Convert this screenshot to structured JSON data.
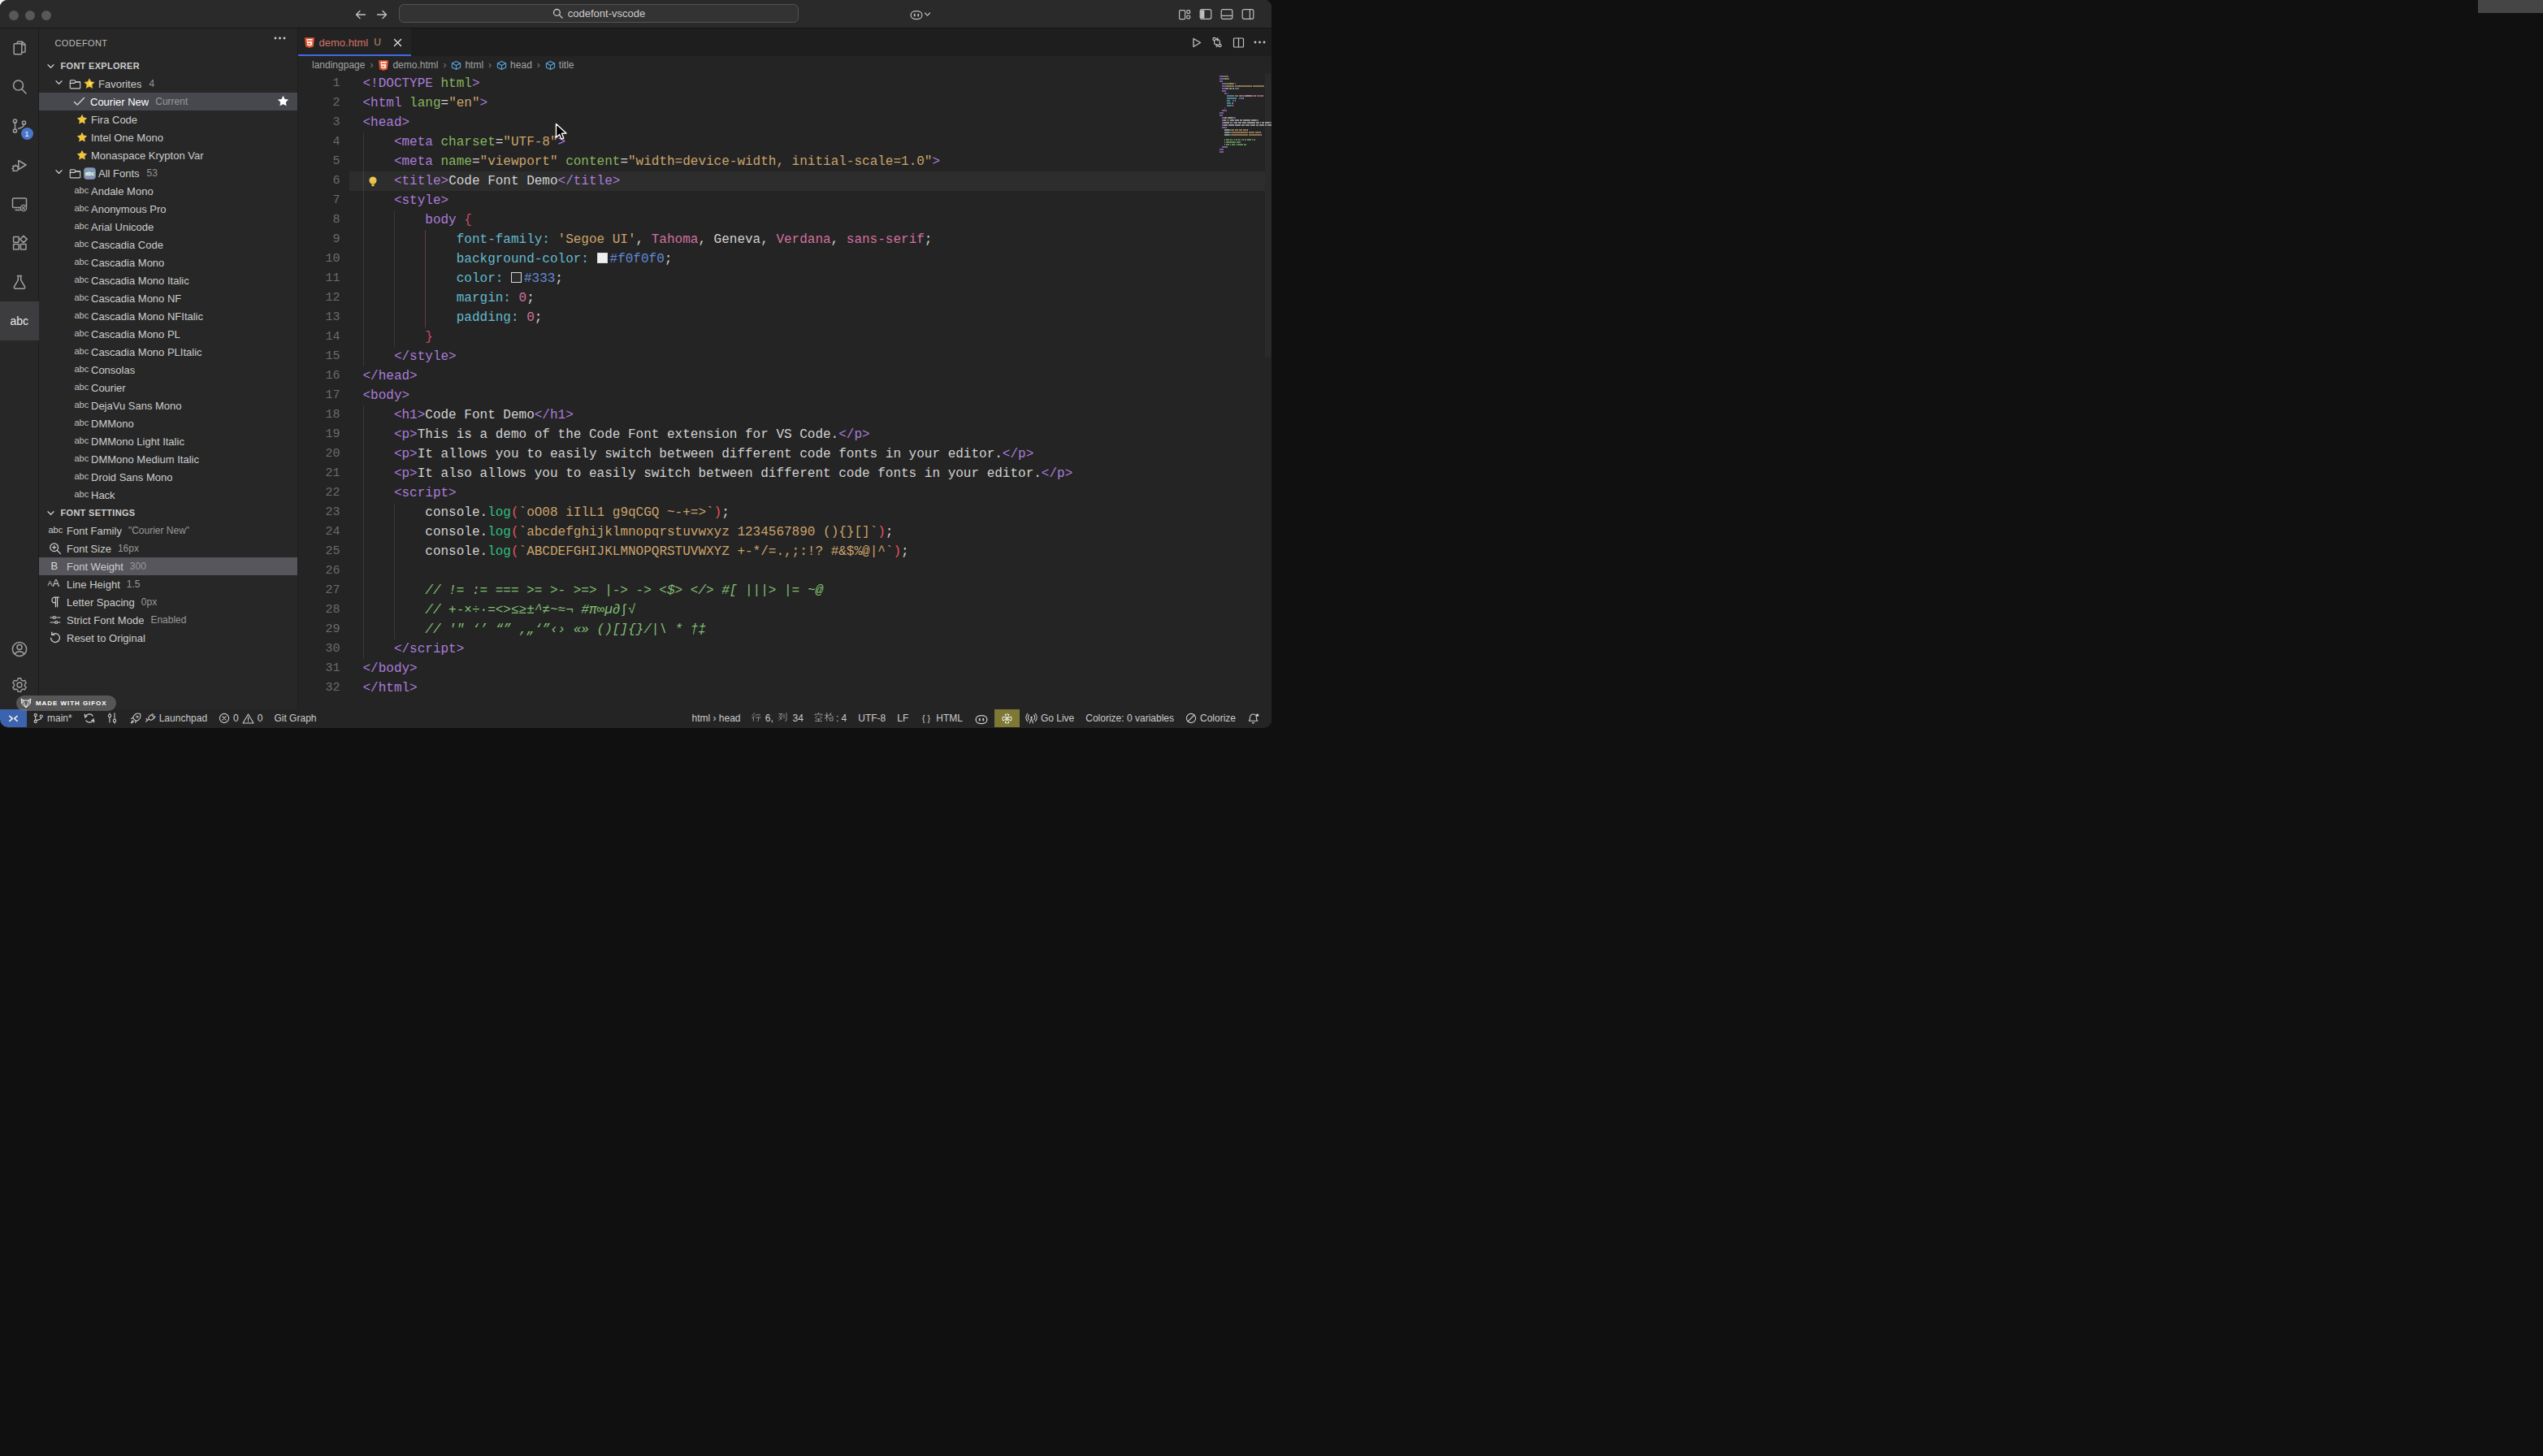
{
  "titlebar": {
    "traffic_lights": [
      "close",
      "minimize",
      "zoom"
    ],
    "nav_icons": [
      "arrow-left",
      "arrow-right"
    ],
    "search_text": "codefont-vscode",
    "right_icons": [
      "copilot",
      "chevron-down",
      "customize-layout",
      "toggle-sidebar",
      "toggle-panel",
      "toggle-secondary-sidebar"
    ]
  },
  "activity_bar": {
    "items": [
      {
        "id": "explorer",
        "icon": "files"
      },
      {
        "id": "search",
        "icon": "search"
      },
      {
        "id": "source-control",
        "icon": "source-control",
        "badge": "1"
      },
      {
        "id": "run-debug",
        "icon": "debug"
      },
      {
        "id": "remote-explorer",
        "icon": "remote-explorer"
      },
      {
        "id": "extensions",
        "icon": "extensions"
      },
      {
        "id": "testing",
        "icon": "beaker"
      },
      {
        "id": "codefont",
        "icon": "abc-text",
        "active": true,
        "label": "abc"
      }
    ],
    "bottom_items": [
      {
        "id": "accounts",
        "icon": "account"
      },
      {
        "id": "settings",
        "icon": "gear"
      }
    ]
  },
  "sidebar": {
    "title": "CODEFONT",
    "menu_icon": "ellipsis",
    "explorer_section": "FONT EXPLORER",
    "tree": [
      {
        "kind": "folder",
        "label": "Favorites",
        "count": "4",
        "badge": "star-emoji"
      },
      {
        "kind": "current",
        "label": "Courier New",
        "meta": "Current",
        "selected": true,
        "right_icon": "star-white"
      },
      {
        "kind": "fav",
        "label": "Fira Code"
      },
      {
        "kind": "fav",
        "label": "Intel One Mono"
      },
      {
        "kind": "fav",
        "label": "Monaspace Krypton Var"
      },
      {
        "kind": "folder",
        "label": "All Fonts",
        "count": "53",
        "badge": "abc-badge"
      },
      {
        "kind": "font",
        "label": "Andale Mono"
      },
      {
        "kind": "font",
        "label": "Anonymous Pro"
      },
      {
        "kind": "font",
        "label": "Arial Unicode"
      },
      {
        "kind": "font",
        "label": "Cascadia Code"
      },
      {
        "kind": "font",
        "label": "Cascadia Mono"
      },
      {
        "kind": "font",
        "label": "Cascadia Mono Italic"
      },
      {
        "kind": "font",
        "label": "Cascadia Mono NF"
      },
      {
        "kind": "font",
        "label": "Cascadia Mono NFItalic"
      },
      {
        "kind": "font",
        "label": "Cascadia Mono PL"
      },
      {
        "kind": "font",
        "label": "Cascadia Mono PLItalic"
      },
      {
        "kind": "font",
        "label": "Consolas"
      },
      {
        "kind": "font",
        "label": "Courier"
      },
      {
        "kind": "font",
        "label": "DejaVu Sans Mono"
      },
      {
        "kind": "font",
        "label": "DMMono"
      },
      {
        "kind": "font",
        "label": "DMMono Light Italic"
      },
      {
        "kind": "font",
        "label": "DMMono Medium Italic"
      },
      {
        "kind": "font",
        "label": "Droid Sans Mono"
      },
      {
        "kind": "font",
        "label": "Hack"
      }
    ],
    "settings_section": "FONT SETTINGS",
    "settings": [
      {
        "icon": "abc-small",
        "label": "Font Family",
        "value": "\"Courier New\""
      },
      {
        "icon": "zoom-in",
        "label": "Font Size",
        "value": "16px"
      },
      {
        "icon": "bold-b",
        "label": "Font Weight",
        "value": "300",
        "selected": true
      },
      {
        "icon": "text-size",
        "label": "Line Height",
        "value": "1.5"
      },
      {
        "icon": "pilcrow",
        "label": "Letter Spacing",
        "value": "0px"
      },
      {
        "icon": "sliders",
        "label": "Strict Font Mode",
        "value": "Enabled"
      },
      {
        "icon": "reset",
        "label": "Reset to Original",
        "value": ""
      }
    ]
  },
  "editor": {
    "tab": {
      "icon": "html5",
      "label": "demo.html",
      "git_status": "U"
    },
    "action_icons": [
      "play",
      "compare-changes",
      "split-editor",
      "ellipsis"
    ],
    "breadcrumbs": [
      {
        "label": "landingpage"
      },
      {
        "icon": "html5",
        "label": "demo.html"
      },
      {
        "icon": "symbol-cube",
        "label": "html"
      },
      {
        "icon": "symbol-cube",
        "label": "head"
      },
      {
        "icon": "symbol-cube",
        "label": "title"
      }
    ],
    "current_line": 6,
    "token_colors": {
      "pu": "#ab7cd9",
      "gr": "#85b65b",
      "st": "#cba36a",
      "tx": "#d2d2d2",
      "pn": "#d2d2d2",
      "cy": "#64b9ce",
      "pk": "#d3709f",
      "bl": "#6189d6",
      "br": "#ce4766",
      "pr": "#e5535c",
      "cm": "#82c073",
      "mt": "#2fbf7f"
    },
    "lines": [
      {
        "n": 1,
        "g": [],
        "t": [
          [
            "<!DOCTYPE ",
            "pu"
          ],
          [
            "html",
            "gr"
          ],
          [
            ">",
            "pu"
          ]
        ]
      },
      {
        "n": 2,
        "g": [],
        "t": [
          [
            "<html ",
            "pu"
          ],
          [
            "lang",
            "gr"
          ],
          [
            "=",
            "pn"
          ],
          [
            "\"en\"",
            "st"
          ],
          [
            ">",
            "pu"
          ]
        ]
      },
      {
        "n": 3,
        "g": [],
        "t": [
          [
            "<head>",
            "pu"
          ]
        ]
      },
      {
        "n": 4,
        "g": [
          0
        ],
        "t": [
          [
            "    ",
            ""
          ],
          [
            "<meta ",
            "pu"
          ],
          [
            "charset",
            "gr"
          ],
          [
            "=",
            "pn"
          ],
          [
            "\"UTF-8\"",
            "st"
          ],
          [
            ">",
            "pu"
          ]
        ]
      },
      {
        "n": 5,
        "g": [
          0
        ],
        "t": [
          [
            "    ",
            ""
          ],
          [
            "<meta ",
            "pu"
          ],
          [
            "name",
            "gr"
          ],
          [
            "=",
            "pn"
          ],
          [
            "\"viewport\"",
            "st"
          ],
          [
            " ",
            ""
          ],
          [
            "content",
            "gr"
          ],
          [
            "=",
            "pn"
          ],
          [
            "\"width=device-width, initial-scale=1.0\"",
            "st"
          ],
          [
            ">",
            "pu"
          ]
        ]
      },
      {
        "n": 6,
        "g": [
          0
        ],
        "t": [
          [
            "    ",
            ""
          ],
          [
            "<title>",
            "pu"
          ],
          [
            "Code Font Demo",
            "tx"
          ],
          [
            "</title>",
            "pu"
          ]
        ],
        "bulb": true
      },
      {
        "n": 7,
        "g": [
          0
        ],
        "t": [
          [
            "    ",
            ""
          ],
          [
            "<style>",
            "pu"
          ]
        ]
      },
      {
        "n": 8,
        "g": [
          0,
          1
        ],
        "t": [
          [
            "        ",
            ""
          ],
          [
            "body ",
            "pu"
          ],
          [
            "{",
            "br"
          ]
        ]
      },
      {
        "n": 9,
        "g": [
          0,
          1
        ],
        "r": 2,
        "t": [
          [
            "            ",
            ""
          ],
          [
            "font-family:",
            "cy"
          ],
          [
            " ",
            ""
          ],
          [
            "'Segoe UI'",
            "st"
          ],
          [
            ", ",
            "pn"
          ],
          [
            "Tahoma",
            "pk"
          ],
          [
            ", ",
            "pn"
          ],
          [
            "Geneva",
            "tx"
          ],
          [
            ", ",
            "pn"
          ],
          [
            "Verdana",
            "pk"
          ],
          [
            ", ",
            "pn"
          ],
          [
            "sans-serif",
            "pk"
          ],
          [
            ";",
            "pn"
          ]
        ]
      },
      {
        "n": 10,
        "g": [
          0,
          1
        ],
        "r": 2,
        "t": [
          [
            "            ",
            ""
          ],
          [
            "background-color:",
            "cy"
          ],
          [
            " ",
            ""
          ],
          [
            "sw",
            "sw",
            "#f0f0f0"
          ],
          [
            "#f0f0f0",
            "bl"
          ],
          [
            ";",
            "pn"
          ]
        ]
      },
      {
        "n": 11,
        "g": [
          0,
          1
        ],
        "r": 2,
        "t": [
          [
            "            ",
            ""
          ],
          [
            "color:",
            "cy"
          ],
          [
            " ",
            ""
          ],
          [
            "sw",
            "sw",
            "#2d2d2d"
          ],
          [
            "#333",
            "bl"
          ],
          [
            ";",
            "pn"
          ]
        ]
      },
      {
        "n": 12,
        "g": [
          0,
          1
        ],
        "r": 2,
        "t": [
          [
            "            ",
            ""
          ],
          [
            "margin:",
            "cy"
          ],
          [
            " ",
            ""
          ],
          [
            "0",
            "pk"
          ],
          [
            ";",
            "pn"
          ]
        ]
      },
      {
        "n": 13,
        "g": [
          0,
          1
        ],
        "r": 2,
        "t": [
          [
            "            ",
            ""
          ],
          [
            "padding:",
            "cy"
          ],
          [
            " ",
            ""
          ],
          [
            "0",
            "pk"
          ],
          [
            ";",
            "pn"
          ]
        ]
      },
      {
        "n": 14,
        "g": [
          0,
          1
        ],
        "t": [
          [
            "        ",
            ""
          ],
          [
            "}",
            "br"
          ]
        ]
      },
      {
        "n": 15,
        "g": [
          0
        ],
        "t": [
          [
            "    ",
            ""
          ],
          [
            "</style>",
            "pu"
          ]
        ]
      },
      {
        "n": 16,
        "g": [],
        "t": [
          [
            "</head>",
            "pu"
          ]
        ]
      },
      {
        "n": 17,
        "g": [],
        "t": [
          [
            "<body>",
            "pu"
          ]
        ]
      },
      {
        "n": 18,
        "g": [
          0
        ],
        "t": [
          [
            "    ",
            ""
          ],
          [
            "<h1>",
            "pu"
          ],
          [
            "Code Font Demo",
            "tx"
          ],
          [
            "</h1>",
            "pu"
          ]
        ]
      },
      {
        "n": 19,
        "g": [
          0
        ],
        "t": [
          [
            "    ",
            ""
          ],
          [
            "<p>",
            "pu"
          ],
          [
            "This is a demo of the Code Font extension for VS Code.",
            "tx"
          ],
          [
            "</p>",
            "pu"
          ]
        ]
      },
      {
        "n": 20,
        "g": [
          0
        ],
        "t": [
          [
            "    ",
            ""
          ],
          [
            "<p>",
            "pu"
          ],
          [
            "It allows you to easily switch between different code fonts in your editor.",
            "tx"
          ],
          [
            "</p>",
            "pu"
          ]
        ]
      },
      {
        "n": 21,
        "g": [
          0
        ],
        "t": [
          [
            "    ",
            ""
          ],
          [
            "<p>",
            "pu"
          ],
          [
            "It also allows you to easily switch between different code fonts in your editor.",
            "tx"
          ],
          [
            "</p>",
            "pu"
          ]
        ]
      },
      {
        "n": 22,
        "g": [
          0
        ],
        "t": [
          [
            "    ",
            ""
          ],
          [
            "<script>",
            "pu"
          ]
        ]
      },
      {
        "n": 23,
        "g": [
          0,
          1
        ],
        "t": [
          [
            "        ",
            ""
          ],
          [
            "console",
            "tx"
          ],
          [
            ".",
            "pn"
          ],
          [
            "log",
            "mt"
          ],
          [
            "(",
            "pr"
          ],
          [
            "`oO08 iIlL1 g9qCGQ ~-+=>`",
            "st"
          ],
          [
            ")",
            "pr"
          ],
          [
            ";",
            "pn"
          ]
        ]
      },
      {
        "n": 24,
        "g": [
          0,
          1
        ],
        "t": [
          [
            "        ",
            ""
          ],
          [
            "console",
            "tx"
          ],
          [
            ".",
            "pn"
          ],
          [
            "log",
            "mt"
          ],
          [
            "(",
            "pr"
          ],
          [
            "`abcdefghijklmnopqrstuvwxyz 1234567890 (){}[]`",
            "st"
          ],
          [
            ")",
            "pr"
          ],
          [
            ";",
            "pn"
          ]
        ]
      },
      {
        "n": 25,
        "g": [
          0,
          1
        ],
        "t": [
          [
            "        ",
            ""
          ],
          [
            "console",
            "tx"
          ],
          [
            ".",
            "pn"
          ],
          [
            "log",
            "mt"
          ],
          [
            "(",
            "pr"
          ],
          [
            "`ABCDEFGHIJKLMNOPQRSTUVWXYZ +-*/=.,;:!? #&$%@|^`",
            "st"
          ],
          [
            ")",
            "pr"
          ],
          [
            ";",
            "pn"
          ]
        ]
      },
      {
        "n": 26,
        "g": [
          0,
          1
        ],
        "t": []
      },
      {
        "n": 27,
        "g": [
          0,
          1
        ],
        "t": [
          [
            "        ",
            ""
          ],
          [
            "// != := === >= >- >=> |-> -> <$> </> #[ |||> |= ~@",
            "cm"
          ]
        ]
      },
      {
        "n": 28,
        "g": [
          0,
          1
        ],
        "t": [
          [
            "        ",
            ""
          ],
          [
            "// +-×÷·=<>≤≥±^≠~≈¬ #π∞µ∂∫√",
            "cm"
          ]
        ]
      },
      {
        "n": 29,
        "g": [
          0,
          1
        ],
        "t": [
          [
            "        ",
            ""
          ],
          [
            "// '\" ‘’ “” ‚„‘”‹› «» ()[]{}/|\\ * †‡",
            "cm"
          ]
        ]
      },
      {
        "n": 30,
        "g": [
          0
        ],
        "t": [
          [
            "    ",
            ""
          ],
          [
            "</script>",
            "pu"
          ]
        ]
      },
      {
        "n": 31,
        "g": [],
        "t": [
          [
            "</body>",
            "pu"
          ]
        ]
      },
      {
        "n": 32,
        "g": [],
        "t": [
          [
            "</html>",
            "pu"
          ]
        ]
      }
    ]
  },
  "status_bar": {
    "left": [
      {
        "id": "remote",
        "icon": "remote",
        "style": "remote"
      },
      {
        "id": "git-branch",
        "icon": "git-branch",
        "label": "main*"
      },
      {
        "id": "git-sync",
        "icon": "sync"
      },
      {
        "id": "commits",
        "icon": "commits"
      },
      {
        "id": "launchpad",
        "icons": [
          "rocket",
          "plug"
        ],
        "label": "Launchpad"
      },
      {
        "id": "problems",
        "icon": "error-circle",
        "label": "0",
        "icon2": "warning-triangle",
        "label2": "0"
      },
      {
        "id": "git-graph",
        "label": "Git Graph"
      }
    ],
    "right": [
      {
        "id": "symbol-path",
        "label": "html › head"
      },
      {
        "id": "cursor-position",
        "label": "行 6, 列 34",
        "render": [
          "@xing",
          " 6, ",
          "@lie",
          " 34"
        ]
      },
      {
        "id": "indentation",
        "label": "空格: 4",
        "render": [
          "@kong",
          "@ge",
          ": 4"
        ]
      },
      {
        "id": "encoding",
        "label": "UTF-8"
      },
      {
        "id": "eol",
        "label": "LF"
      },
      {
        "id": "language-mode",
        "icon": "braces",
        "label": "HTML"
      },
      {
        "id": "copilot-status",
        "icon": "copilot"
      },
      {
        "id": "extension-olive",
        "icon": "pinwheel",
        "style": "olive"
      },
      {
        "id": "go-live",
        "icon": "broadcast",
        "label": "Go Live"
      },
      {
        "id": "colorize-variables",
        "label": "Colorize: 0 variables"
      },
      {
        "id": "colorize",
        "icon": "circle-slash",
        "label": "Colorize"
      },
      {
        "id": "notifications",
        "icon": "bell-dot"
      }
    ]
  },
  "gifox": {
    "label": "MADE WITH GIFOX",
    "icon": "fox"
  }
}
